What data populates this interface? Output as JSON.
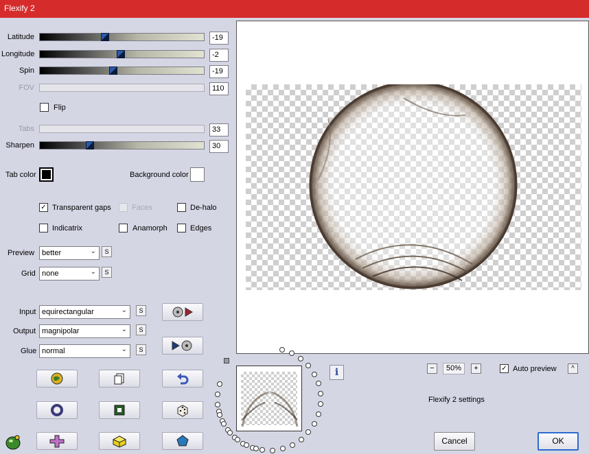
{
  "window": {
    "title": "Flexify 2"
  },
  "sliders": [
    {
      "label": "Latitude",
      "value": "-19",
      "level": 0.405,
      "disabled": false
    },
    {
      "label": "Longitude",
      "value": "-2",
      "level": 0.495,
      "disabled": false
    },
    {
      "label": "Spin",
      "value": "-19",
      "level": 0.445,
      "disabled": false
    },
    {
      "label": "FOV",
      "value": "110",
      "level": null,
      "disabled": true
    },
    {
      "label": "Tabs",
      "value": "33",
      "level": null,
      "disabled": true
    },
    {
      "label": "Sharpen",
      "value": "30",
      "level": 0.305,
      "disabled": false
    }
  ],
  "flip": {
    "label": "Flip",
    "checked": false
  },
  "colors": {
    "tab_color_label": "Tab color",
    "background_color_label": "Background color",
    "tab_color": "#000000",
    "background_color": "#ffffff"
  },
  "options": {
    "transparent_gaps": {
      "label": "Transparent gaps",
      "checked": true
    },
    "faces": {
      "label": "Faces",
      "checked": false,
      "disabled": true
    },
    "de_halo": {
      "label": "De-halo",
      "checked": false
    },
    "indicatrix": {
      "label": "Indicatrix",
      "checked": false
    },
    "anamorph": {
      "label": "Anamorph",
      "checked": false
    },
    "edges": {
      "label": "Edges",
      "checked": false
    }
  },
  "preview": {
    "label": "Preview",
    "value": "better",
    "s": "S"
  },
  "grid": {
    "label": "Grid",
    "value": "none",
    "s": "S"
  },
  "input": {
    "label": "Input",
    "value": "equirectangular",
    "s": "S"
  },
  "output": {
    "label": "Output",
    "value": "magnipolar",
    "s": "S"
  },
  "glue": {
    "label": "Glue",
    "value": "normal",
    "s": "S"
  },
  "zoom": {
    "minus": "−",
    "value": "50%",
    "plus": "+"
  },
  "auto_preview": {
    "label": "Auto preview",
    "checked": true,
    "collapse": "^"
  },
  "info": "i",
  "settings_label": "Flexify 2 settings",
  "cancel_label": "Cancel",
  "ok_label": "OK",
  "accent": "#d62b2b"
}
